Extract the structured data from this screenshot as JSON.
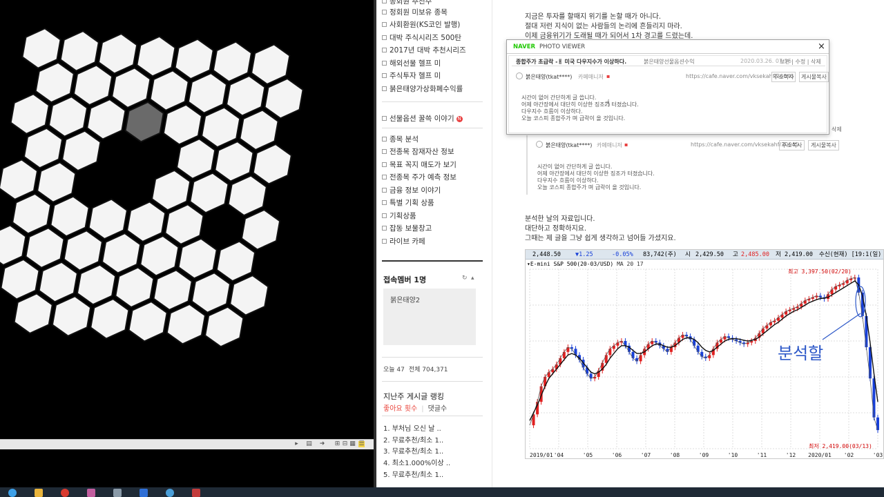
{
  "sidebar": {
    "items_top": [
      {
        "label": "종회원 추천주"
      },
      {
        "label": "정회원 미보유 종목"
      },
      {
        "label": "사회환원(KS코인 발행)"
      },
      {
        "label": "대박 주식시리즈 500탄"
      },
      {
        "label": "2017년 대박 추천시리즈"
      },
      {
        "label": "해외선물 헬프 미"
      },
      {
        "label": "주식투자 헬프 미"
      },
      {
        "label": "붉은태양가상화폐수익률"
      }
    ],
    "story_item": {
      "label": "선물옵션 꿀쓱 이야기",
      "badge": "N"
    },
    "items_mid": [
      {
        "label": "종목 분석"
      },
      {
        "label": "전종목 잠재자산 정보"
      },
      {
        "label": "목표 꼭지 매도가 보기"
      },
      {
        "label": "전종목 주가 예측 정보"
      },
      {
        "label": "금융 정보 이야기"
      },
      {
        "label": "특별 기획 상품"
      },
      {
        "label": "기획상품"
      },
      {
        "label": "잡동 보물창고"
      },
      {
        "label": "라이브 카페"
      }
    ],
    "member_title": "접속멤버 1명",
    "member_refresh": "↻",
    "member_toggle": "▴",
    "member_name": "붉은태양2",
    "visit_today": "오늘 47",
    "visit_total": "전체 704,371",
    "rank_title": "지난주 게시글 랭킹",
    "rank_tab_likes": "좋아요 횟수",
    "rank_tab_comments": "댓글수",
    "rank_items": [
      {
        "label": "1. 부처님 오신 날 .."
      },
      {
        "label": "2. 무료추천/최소 1.."
      },
      {
        "label": "3. 무료추천/최소 1.."
      },
      {
        "label": "4. 최소1.000%이상 .."
      },
      {
        "label": "5. 무료추천/최소 1.."
      }
    ]
  },
  "post": {
    "line1": "지금은 투자를 할때지 위기를 논할 때가 아니다.",
    "line2": "절대 저런 지식이 없는 사람들의 논리에 흔들리지 마라.",
    "line3": "이제 금융위기가 도래될 때가 되어서 1차 경고를 드렸는데.",
    "side_link": "삭제",
    "analysis1": "분석한 날의 자료입니다.",
    "analysis2": "대단하고 정확하지요.",
    "analysis3": "그때는 제 글을 그냥 쉽게 생각하고 넘어들 가셨지요."
  },
  "quote": {
    "author": "붉은태양(tkat****)",
    "author_sub": "카페매니저",
    "url": "https://cafe.naver.com/vksekahf/30045",
    "btn_addr": "주소복사",
    "btn_report": "게시물복사",
    "body1": "시간이 없어 간단하게 글 씁니다.",
    "body2": "어제 야간장에서 대단히 이상한 징조가 터졌습니다.",
    "body3": "다우지수 흐름이 이상하다.",
    "body4": "오늘 코스피 종합주가 며 급락이 올 것입니다."
  },
  "viewer": {
    "brand": "NAVER",
    "title": "PHOTO VIEWER",
    "close": "×",
    "post_title": "종합주가 초급락 -ㅐ 미국 다우지수가 이상하다.",
    "post_board": "붉은태양선물옵션수익",
    "post_date": "2020.03.26. 07:56",
    "actions": "보관 | 수정 | 삭제"
  },
  "chart_data": {
    "type": "line",
    "header": {
      "last": "2,448.50",
      "change": "▼1.25",
      "pct": "-0.05%",
      "volume": "83,742(주)",
      "open_label": "시",
      "open": "2,429.50",
      "high_label": "고",
      "high": "2,485.00",
      "low_label": "저",
      "low": "2,419.00",
      "mode": "수신(현재) [19:1(일)"
    },
    "title": "▾E-mini S&P 500(20-03/USD)",
    "ma_label": "MA 20 17",
    "high_annotation": "최고 3,397.50(02/20)",
    "low_annotation": "최저 2,419.00(03/13)",
    "handwriting": "분석할",
    "x_labels": [
      "2019/01",
      "'04",
      "'05",
      "'06",
      "'07",
      "'08",
      "'09",
      "'10",
      "'11",
      "'12",
      "2020/01",
      "'02",
      "'03"
    ],
    "ylim": [
      2300,
      3450
    ],
    "series": [
      {
        "values": [
          2450,
          2520,
          2600,
          2700,
          2760,
          2790,
          2810,
          2840,
          2880,
          2920,
          2950,
          2940,
          2900,
          2870,
          2820,
          2780,
          2750,
          2760,
          2800,
          2850,
          2900,
          2940,
          2960,
          2980,
          2990,
          2960,
          2920,
          2880,
          2860,
          2900,
          2940,
          2970,
          2990,
          2980,
          2960,
          2940,
          2920,
          2950,
          2980,
          3010,
          3030,
          3020,
          3000,
          2960,
          2920,
          2890,
          2880,
          2900,
          2940,
          2980,
          3000,
          3020,
          3010,
          3000,
          2990,
          2980,
          2970,
          2980,
          2990,
          3010,
          3040,
          3070,
          3090,
          3110,
          3120,
          3140,
          3160,
          3180,
          3190,
          3200,
          3210,
          3230,
          3250,
          3260,
          3270,
          3280,
          3270,
          3260,
          3290,
          3320,
          3340,
          3350,
          3360,
          3380,
          3390,
          3397,
          3300,
          3150,
          2950,
          2750,
          2500,
          2419
        ]
      },
      {
        "values": [
          2480,
          2530,
          2580,
          2640,
          2700,
          2750,
          2780,
          2810,
          2840,
          2870,
          2900,
          2910,
          2900,
          2880,
          2850,
          2820,
          2790,
          2780,
          2790,
          2810,
          2840,
          2880,
          2910,
          2940,
          2960,
          2960,
          2950,
          2930,
          2910,
          2910,
          2920,
          2940,
          2960,
          2970,
          2970,
          2960,
          2950,
          2950,
          2960,
          2980,
          3000,
          3010,
          3010,
          3000,
          2980,
          2950,
          2930,
          2920,
          2930,
          2950,
          2970,
          2990,
          3000,
          3005,
          3005,
          3000,
          2995,
          2990,
          2995,
          3000,
          3015,
          3035,
          3055,
          3075,
          3095,
          3110,
          3130,
          3150,
          3165,
          3180,
          3190,
          3205,
          3220,
          3235,
          3245,
          3255,
          3262,
          3265,
          3270,
          3285,
          3300,
          3315,
          3330,
          3345,
          3360,
          3375,
          3350,
          3280,
          3150,
          2980,
          2780,
          2600
        ]
      }
    ]
  },
  "video": {
    "controls": [
      "⊞",
      "⊟",
      "▦",
      "☰"
    ]
  },
  "taskbar": {
    "icons": [
      "start-icon",
      "explorer-icon",
      "chrome-icon",
      "app-icon",
      "app-icon-2",
      "app-icon-3",
      "app-icon-4",
      "app-icon-5"
    ]
  },
  "colors": {
    "up": "#e02020",
    "down": "#1840d8",
    "ma": "#111111",
    "annotation_red": "#d00000",
    "handwriting_blue": "#2d58c8",
    "naver_green": "#1ec800"
  }
}
